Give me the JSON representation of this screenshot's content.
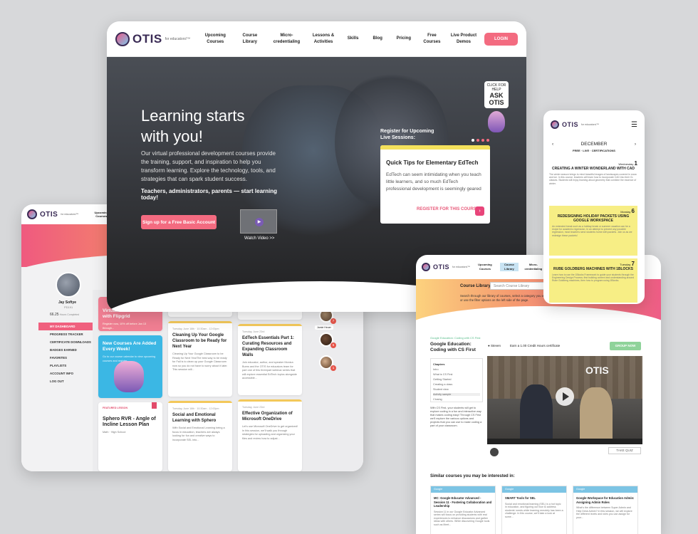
{
  "main": {
    "brand": {
      "word": "OTIS",
      "sub": "for educators!™"
    },
    "nav": [
      "Upcoming Courses",
      "Course Library",
      "Micro-credentialing",
      "Lessons & Activities",
      "Skills",
      "Blog",
      "Pricing",
      "Free Courses",
      "Live Product Demos"
    ],
    "login": "LOGIN",
    "hero": {
      "title": "Learning starts with you!",
      "body": "Our virtual professional development courses provide the training, support, and inspiration to help you transform learning. Explore the technology, tools, and strategies that can spark student success.",
      "strong": "Teachers, administrators, parents — start learning today!",
      "signup": "Sign up for a Free Basic Account",
      "watch": "Watch Video >>",
      "register": "Register for Upcoming Live Sessions:",
      "ask_top": "CLICK FOR HELP",
      "ask_main": "ASK OTIS"
    },
    "tips": {
      "title": "Quick Tips for Elementary EdTech",
      "body": "EdTech can seem intimidating when you teach little learners, and so much EdTech professional development is seemingly geared to...",
      "cta": "REGISTER FOR THIS COURSE:",
      "go": "GO"
    }
  },
  "dashboard": {
    "nav": "Upcoming Courses",
    "user": {
      "name": "Jay Softye",
      "id": "PD191",
      "points": "66.25",
      "points_label": "Hours Completed"
    },
    "menu": [
      "MY DASHBOARD",
      "PROGRESS TRACKER",
      "CERTIFICATE DOWNLOADS",
      "BADGES EARNED",
      "FAVORITES",
      "PLAYLISTS",
      "ACCOUNT INFO",
      "LOG OUT"
    ],
    "promo1": {
      "title": "Virtual Pen Pals for ELLs with Flipgrid",
      "body": "Register now, 10% off before Jan 13 through..."
    },
    "promo2": {
      "title": "New Courses Are Added Every Week!",
      "body": "Go to our course calendar to view upcoming courses and register."
    },
    "featured": {
      "flag": "FEATURED LESSON",
      "title": "Sphero RVR - Angle of Incline Lesson Plan",
      "meta": "Math · High School"
    },
    "col2": [
      {
        "meta": "",
        "title": "",
        "body": "engage your ELLs through Flipgrid? Learn how to provide learning opportunities for our students using Google Drawings. We'll demonstrate how..."
      },
      {
        "meta": "Tuesday, June 16th · 10:30am - 12:00pm",
        "title": "Cleaning Up Your Google Classroom to be Ready for Next Year",
        "body": "Cleaning Up Your Google Classroom to be Ready for Next YearThe best way to be ready for Fall is to clean up your Google Classroom now so you do not have to worry about it later. This session will..."
      },
      {
        "meta": "Tuesday, June 16th · 10:30am - 12:00pm",
        "title": "Social and Emotional Learning with Sphero",
        "body": "With Social and Emotional Learning being a focus in education, teachers are always looking for fun and creative ways to incorporate SEL into..."
      }
    ],
    "col3": [
      {
        "meta": "",
        "title": "",
        "body": "of different subjects! We will be exploring topics from coding, to electronics, to art and 3D printing..."
      },
      {
        "meta": "Tuesday, June 23rd",
        "title": "EdTech Essentials Part 1: Curating Resources and Expanding Classroom Walls",
        "body": "Join educator, author, and speaker Monica Burns and the OTIS for educators team for part one of this threepart webinar series that will explore essential EdTech topics alongside accessible..."
      },
      {
        "meta": "Tuesday, June 23rd",
        "title": "Effective Organization of Microsoft OneDrive",
        "body": "Let's use Microsoft OneDrive to get organized! In this session, we'll walk you through strategies for uploading and organizing your files and review how to adjust..."
      }
    ],
    "avatars": [
      {
        "name": "Jamie Heuer",
        "count": "7"
      },
      {
        "count": "5"
      },
      {
        "count": "1"
      }
    ]
  },
  "course": {
    "nav": [
      "Upcoming Courses",
      "Course Library",
      "Micro-credentialing",
      "Lessons & Activities",
      "Skills"
    ],
    "library_label": "Course Library:",
    "search_placeholder": "Search Course Library",
    "desc": "Search through our library of courses, select a category you want to explore, or use the filter options on the left side of the page.",
    "breadcrumb": "Google Education: Coding with CS First",
    "title": "Google Education: Coding with CS First",
    "instructor": "Steven",
    "earn": "Earn a 1.00 Credit Hours certificate",
    "group": "GROUP NOW",
    "chapters": "Chapters",
    "chapter_items": [
      "Intro",
      "What is CS First",
      "Getting Started",
      "Creating a class",
      "Student view",
      "Activity sample",
      "Closing"
    ],
    "desc2": "With CS First, your students will get to explore coding in a fun and interactive way that makes coding easy! Through CS First we'll explore the various options and projects that you can use to make coding a part of your classroom.",
    "video_logo": "OTIS",
    "quiz": "TAKE QUIZ",
    "similar": "Similar courses you may be interested in:",
    "similar_cards": [
      {
        "tag": "Google",
        "title": "MC: Google Educator Advanced - Session 11 - Fostering Collaboration and Leadership",
        "body": "Session 11 in our Google Educator Advanced series will focus on providing students with real experiences to enhance discussions and gather ideas with others. While discovering Google tools such as Meet..."
      },
      {
        "tag": "Google",
        "title": "SMART Tools for SEL",
        "body": "Social and emotional learning (SEL) is a hot topic in education, and figuring out how to address students' needs while learning remotely has been a challenge. In this course, we'll take a look at some..."
      },
      {
        "tag": "Google",
        "title": "Google Workspace for Education Admin: Assigning Admin Roles",
        "body": "What's the difference between Super Admin and Help Desk Admin? In this session, we will explore the different levels and roles you can assign for your..."
      }
    ]
  },
  "phone": {
    "month": "DECEMBER",
    "legend": "FREE · LIVE · CERTIFICATIONS",
    "events": [
      {
        "day": "Wednesday",
        "num": "1",
        "title": "CREATING A WINTER WONDERLAND WITH CAD",
        "body": "The winter season brings to mind beautiful images of landscapes covered in snow and ice. In this course, teachers will learn how to incorporate CAD into their CL classes. Students will enjoy learning about geometry that combine the essence of winter."
      },
      {
        "day": "Monday",
        "num": "6",
        "title": "REDESIGNING HOLIDAY PACKETS USING GOOGLE WORKSPACE",
        "body": "An extended break such as a holiday break or summer vacation can be a recipe for academic regression. In an attempt to prevent any possible regression, most teachers send students home with packets. Join us as we redesign these packets!"
      },
      {
        "day": "Tuesday",
        "num": "7",
        "title": "RUBE GOLDBERG MACHINES WITH 1BLOCKS",
        "body": "Learn how to use the 1Blocks Framework to guide your students through the Engineering Design Process; first building context and understanding around Rube Goldberg machines, then how to program using 1Blocks."
      }
    ]
  }
}
